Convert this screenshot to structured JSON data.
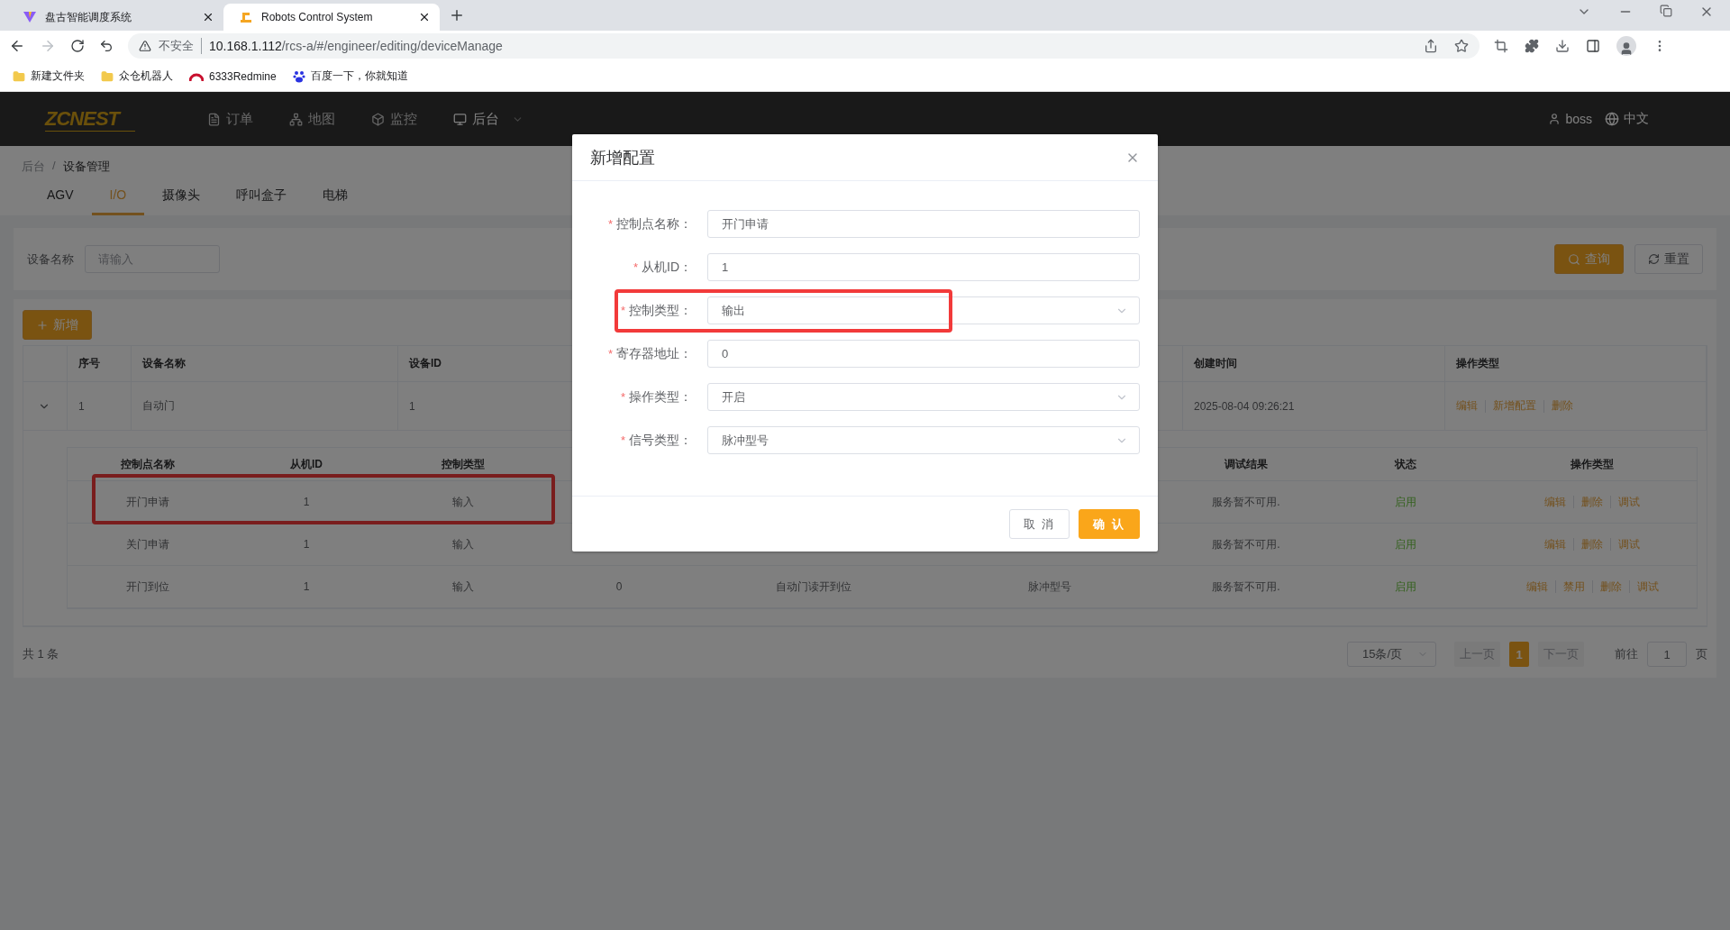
{
  "browser": {
    "tabs": [
      {
        "title": "盘古智能调度系统",
        "kind": "vite",
        "selected": false
      },
      {
        "title": "Robots Control System",
        "kind": "robot",
        "selected": true
      }
    ],
    "security_label": "不安全",
    "url_host": "10.168.1.112",
    "url_path": "/rcs-a/#/engineer/editing/deviceManage",
    "bookmarks": [
      {
        "label": "新建文件夹",
        "kind": "folder"
      },
      {
        "label": "众仓机器人",
        "kind": "folder"
      },
      {
        "label": "6333Redmine",
        "kind": "redmine"
      },
      {
        "label": "百度一下，你就知道",
        "kind": "baidu"
      }
    ]
  },
  "app": {
    "logo": "ZCNEST",
    "nav": [
      {
        "label": "订单",
        "kind": "order",
        "selected": false
      },
      {
        "label": "地图",
        "kind": "map",
        "selected": false
      },
      {
        "label": "监控",
        "kind": "monitor",
        "selected": false
      },
      {
        "label": "后台",
        "kind": "admin",
        "selected": true
      }
    ],
    "user": "boss",
    "language": "中文"
  },
  "breadcrumb": [
    "后台",
    "设备管理"
  ],
  "breadcrumb_separator": "/",
  "tabs": [
    {
      "label": "AGV",
      "selected": false
    },
    {
      "label": "I/O",
      "selected": true
    },
    {
      "label": "摄像头",
      "selected": false
    },
    {
      "label": "呼叫盒子",
      "selected": false
    },
    {
      "label": "电梯",
      "selected": false
    }
  ],
  "search": {
    "label": "设备名称",
    "placeholder": "请输入",
    "query_button": "查询",
    "reset_button": "重置"
  },
  "add_button": "新增",
  "table": {
    "columns": {
      "index": "序号",
      "name": "设备名称",
      "device_id": "设备ID",
      "created": "创建时间",
      "actions": "操作类型"
    },
    "rows": [
      {
        "index": "1",
        "name": "自动门",
        "device_id": "1",
        "created": "2025-08-04 09:26:21",
        "expanded": true,
        "actions": [
          "编辑",
          "新增配置",
          "删除"
        ],
        "sub_table": {
          "columns": {
            "name": "控制点名称",
            "slave_id": "从机ID",
            "control_type": "控制类型",
            "debug_result": "调试结果",
            "status": "状态",
            "actions": "操作类型"
          },
          "rows": [
            {
              "name": "开门申请",
              "slave_id": "1",
              "control_type": "输入",
              "debug_result": "服务暂不可用.",
              "status": "启用",
              "highlighted": true,
              "actions": [
                "编辑",
                "删除",
                "调试"
              ]
            },
            {
              "name": "关门申请",
              "slave_id": "1",
              "control_type": "输入",
              "debug_result": "服务暂不可用.",
              "status": "启用",
              "highlighted": false,
              "actions": [
                "编辑",
                "删除",
                "调试"
              ]
            },
            {
              "name": "开门到位",
              "slave_id": "1",
              "control_type": "输入",
              "register": "0",
              "description": "自动门读开到位",
              "signal_type": "脉冲型号",
              "debug_result": "服务暂不可用.",
              "status": "启用",
              "highlighted": false,
              "actions": [
                "编辑",
                "禁用",
                "删除",
                "调试"
              ]
            }
          ]
        }
      }
    ]
  },
  "footer": {
    "total": "共 1 条",
    "page_size": "15条/页",
    "prev": "上一页",
    "pages": [
      {
        "label": "1",
        "selected": true
      }
    ],
    "next": "下一页",
    "goto_label": "前往",
    "goto_value": "1",
    "goto_suffix": "页"
  },
  "dialog": {
    "title": "新增配置",
    "required_mark": "*",
    "fields": [
      {
        "label": "控制点名称：",
        "value": "开门申请",
        "kind": "input",
        "highlighted": false
      },
      {
        "label": "从机ID：",
        "value": "1",
        "kind": "input",
        "highlighted": false
      },
      {
        "label": "控制类型：",
        "value": "输出",
        "kind": "select",
        "highlighted": true
      },
      {
        "label": "寄存器地址：",
        "value": "0",
        "kind": "input",
        "highlighted": false
      },
      {
        "label": "操作类型：",
        "value": "开启",
        "kind": "select",
        "highlighted": false
      },
      {
        "label": "信号类型：",
        "value": "脉冲型号",
        "kind": "select",
        "highlighted": false
      }
    ],
    "cancel": "取 消",
    "confirm": "确 认"
  }
}
